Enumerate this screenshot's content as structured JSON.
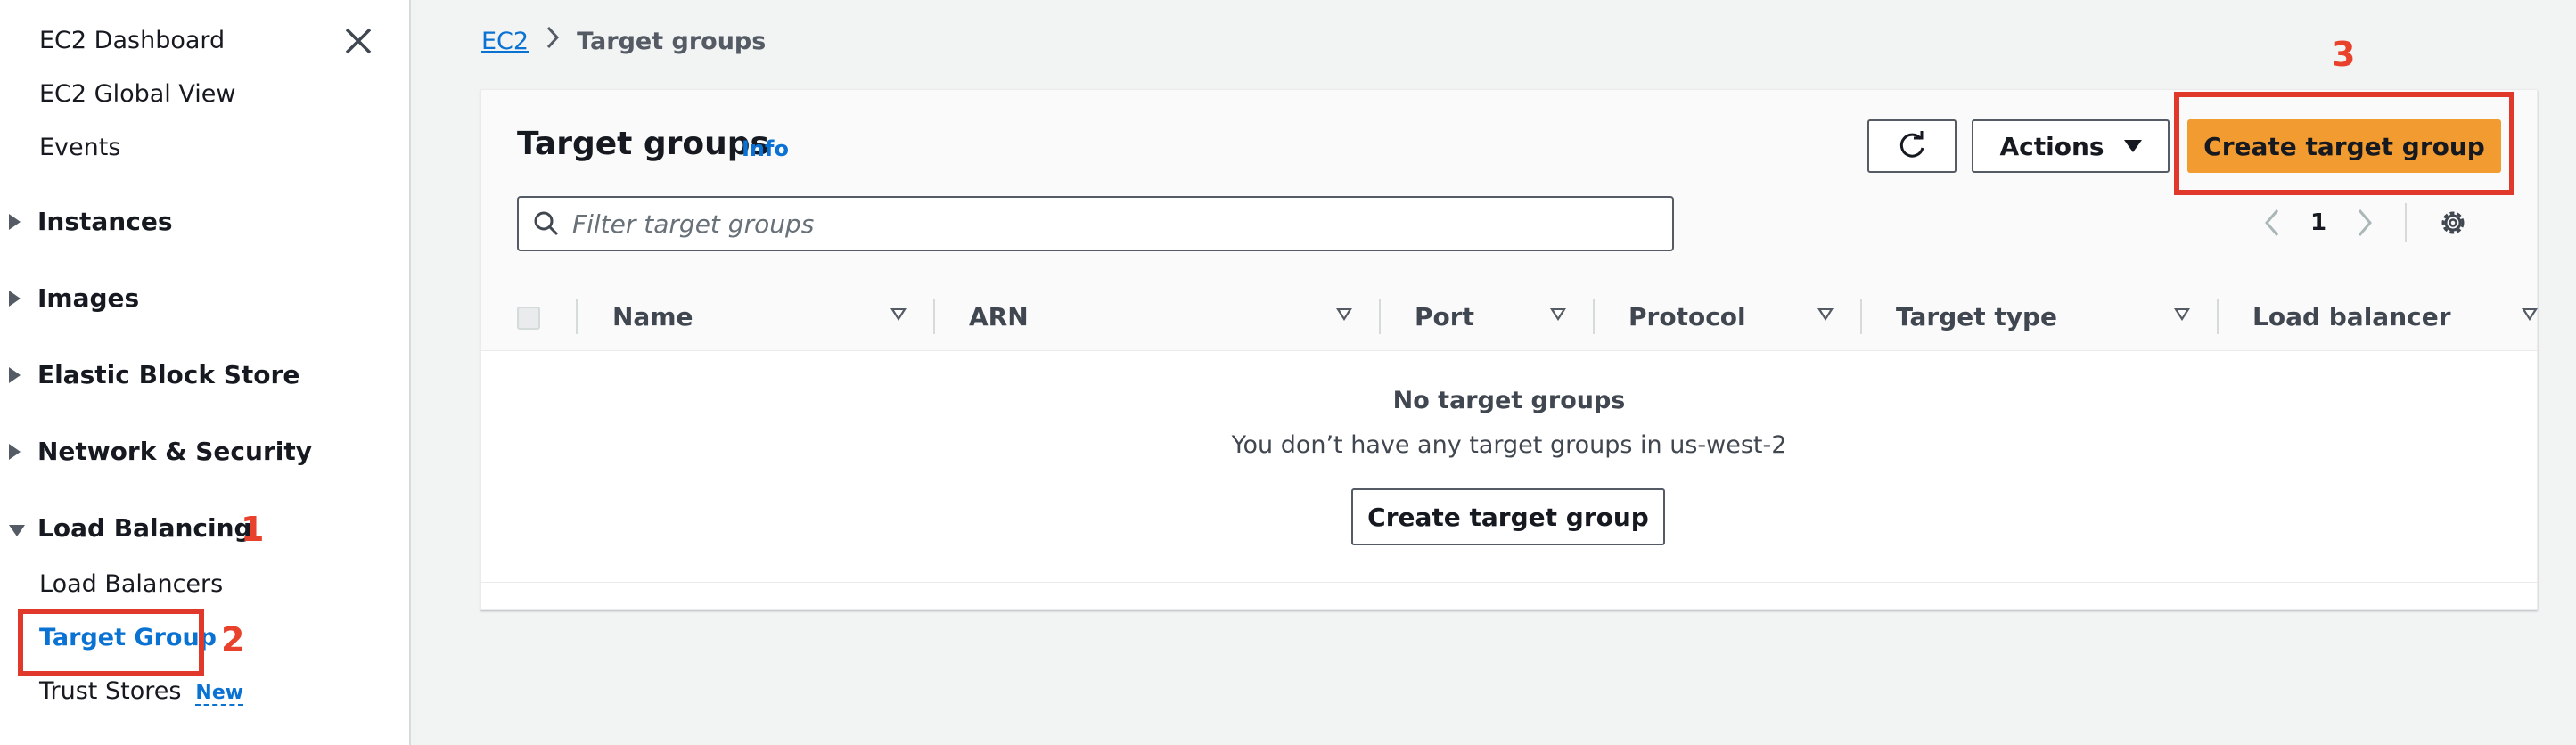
{
  "sidebar": {
    "links_top": [
      "EC2 Dashboard",
      "EC2 Global View",
      "Events"
    ],
    "sections": [
      "Instances",
      "Images",
      "Elastic Block Store",
      "Network & Security",
      "Load Balancing"
    ],
    "load_balancing_items": [
      "Load Balancers",
      "Target Group",
      "Trust Stores"
    ],
    "new_badge": "New",
    "icons": {
      "close": "close-icon"
    }
  },
  "annotations": [
    "1",
    "2",
    "3"
  ],
  "breadcrumb": {
    "root": "EC2",
    "current": "Target groups"
  },
  "panel": {
    "title": "Target groups",
    "info": "Info",
    "actions_label": "Actions",
    "create_label": "Create target group",
    "filter_placeholder": "Filter target groups",
    "page_number": "1",
    "columns": [
      "Name",
      "ARN",
      "Port",
      "Protocol",
      "Target type",
      "Load balancer"
    ],
    "empty_title": "No target groups",
    "empty_desc": "You don’t have any target groups in us-west-2",
    "empty_button": "Create target group"
  },
  "colors": {
    "primary_button": "#f29b30",
    "link": "#0972d3",
    "annotation": "#e0382b"
  }
}
